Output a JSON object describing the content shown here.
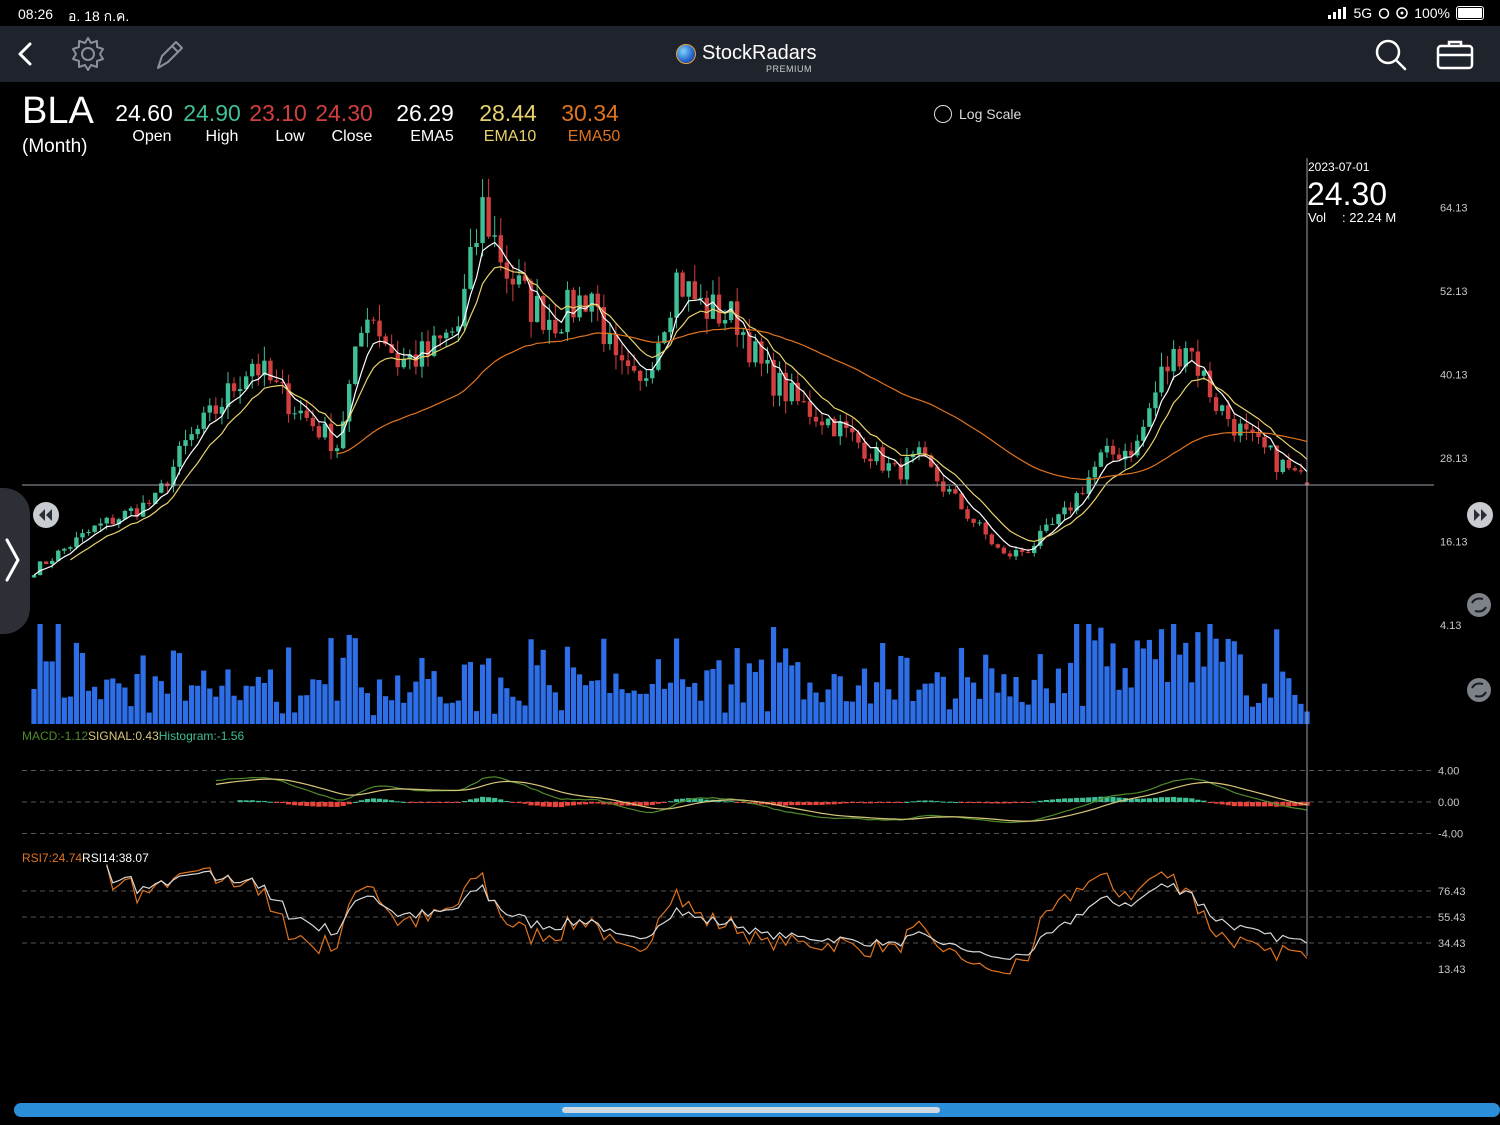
{
  "status": {
    "time": "08:26",
    "date": "อ. 18 ก.ค.",
    "network": "5G",
    "battery": "100%"
  },
  "toolbar": {
    "brand": "StockRadars",
    "badge": "PREMIUM"
  },
  "quote": {
    "symbol": "BLA",
    "period": "(Month)",
    "open": "24.60",
    "high": "24.90",
    "low": "23.10",
    "close": "24.30",
    "ema5": "26.29",
    "ema10": "28.44",
    "ema50": "30.34",
    "labels": {
      "open": "Open",
      "high": "High",
      "low": "Low",
      "close": "Close",
      "ema5": "EMA5",
      "ema10": "EMA10",
      "ema50": "EMA50"
    }
  },
  "options": {
    "log_scale_label": "Log Scale",
    "log_scale_checked": false
  },
  "crosshair": {
    "date": "2023-07-01",
    "price": "24.30",
    "vol_label": "Vol",
    "vol_value": ": 22.24 M"
  },
  "colors": {
    "up": "#3fbf98",
    "down": "#d23f3f",
    "ema5": "#ffffff",
    "ema10": "#e8d36a",
    "ema50": "#e0741f",
    "volume": "#2e6ee6",
    "macd": "#4f8a2c",
    "signal": "#d8c67a",
    "rsi7": "#e0741f",
    "rsi14": "#d8d8d8"
  },
  "chart_data": {
    "type": "candlestick",
    "price_axis": {
      "ticks": [
        "64.13",
        "52.13",
        "40.13",
        "28.13",
        "16.13",
        "4.13"
      ]
    },
    "macd": {
      "legend": {
        "macd": "MACD:-1.12",
        "signal": "SIGNAL:0.43",
        "histogram": "Histogram:-1.56"
      },
      "ticks": [
        "4.00",
        "0.00",
        "-4.00"
      ]
    },
    "rsi": {
      "legend": {
        "rsi7": "RSI7:24.74",
        "rsi14": "RSI14:38.07"
      },
      "ticks": [
        "76.43",
        "55.43",
        "34.43",
        "13.43"
      ]
    },
    "last": {
      "open": 24.6,
      "high": 24.9,
      "low": 23.1,
      "close": 24.3
    },
    "close_anchors": [
      [
        0,
        12
      ],
      [
        10,
        18
      ],
      [
        20,
        22
      ],
      [
        25,
        30
      ],
      [
        30,
        35
      ],
      [
        36,
        42
      ],
      [
        40,
        38
      ],
      [
        46,
        33
      ],
      [
        50,
        30
      ],
      [
        55,
        50
      ],
      [
        60,
        42
      ],
      [
        65,
        43
      ],
      [
        70,
        47
      ],
      [
        74,
        64
      ],
      [
        78,
        55
      ],
      [
        82,
        50
      ],
      [
        86,
        48
      ],
      [
        92,
        52
      ],
      [
        96,
        41
      ],
      [
        100,
        38
      ],
      [
        106,
        54
      ],
      [
        110,
        50
      ],
      [
        116,
        48
      ],
      [
        120,
        41
      ],
      [
        126,
        36
      ],
      [
        132,
        33
      ],
      [
        138,
        29
      ],
      [
        142,
        26
      ],
      [
        146,
        28
      ],
      [
        150,
        24
      ],
      [
        155,
        19
      ],
      [
        160,
        14
      ],
      [
        164,
        15
      ],
      [
        170,
        20
      ],
      [
        176,
        28
      ],
      [
        182,
        30
      ],
      [
        186,
        40
      ],
      [
        190,
        45
      ],
      [
        195,
        36
      ],
      [
        200,
        31
      ],
      [
        206,
        27
      ],
      [
        210,
        24.3
      ]
    ]
  }
}
